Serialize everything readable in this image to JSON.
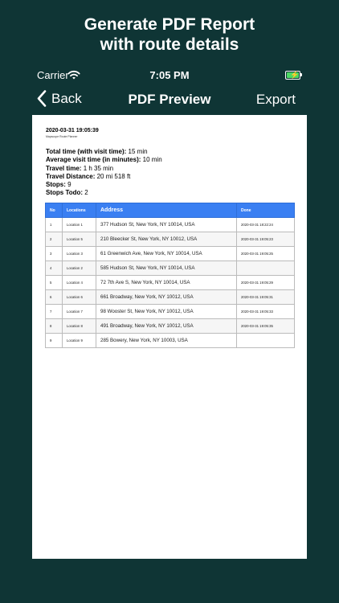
{
  "promo": {
    "line1": "Generate PDF Report",
    "line2": "with route details"
  },
  "status_bar": {
    "carrier": "Carrier",
    "time": "7:05 PM"
  },
  "nav": {
    "back_label": "Back",
    "title": "PDF Preview",
    "export_label": "Export"
  },
  "document": {
    "date": "2020-03-31 19:05:39",
    "subtitle": "Mapscope Route Planner",
    "summary": [
      {
        "label": "Total time (with visit time):",
        "value": " 15 min"
      },
      {
        "label": "Average visit time (in minutes):",
        "value": " 10 min"
      },
      {
        "label": "Travel time:",
        "value": " 1 h 35 min"
      },
      {
        "label": "Travel Distance:",
        "value": " 20 mi 518 ft"
      },
      {
        "label": "Stops:",
        "value": " 9"
      },
      {
        "label": "Stops Todo:",
        "value": " 2"
      }
    ],
    "table": {
      "headers": [
        "No",
        "Locations",
        "Address",
        "Done"
      ],
      "rows": [
        {
          "no": "1",
          "location": "Location 1",
          "address": "377 Hudson St, New York, NY 10014, USA",
          "done": "2020-03-31 18:22:24"
        },
        {
          "no": "2",
          "location": "Location 5",
          "address": "210 Bleecker St, New York, NY 10012, USA",
          "done": "2020-03-31 19:05:23"
        },
        {
          "no": "3",
          "location": "Location 3",
          "address": "61 Greenwich Ave, New York, NY 10014, USA",
          "done": "2020-03-31 19:05:25"
        },
        {
          "no": "4",
          "location": "Location 2",
          "address": "585 Hudson St, New York, NY 10014, USA",
          "done": ""
        },
        {
          "no": "5",
          "location": "Location 4",
          "address": "72 7th Ave S, New York, NY 10014, USA",
          "done": "2020-03-31 19:05:29"
        },
        {
          "no": "6",
          "location": "Location 6",
          "address": "661 Broadway, New York, NY 10012, USA",
          "done": "2020-03-31 19:05:31"
        },
        {
          "no": "7",
          "location": "Location 7",
          "address": "98 Wooster St, New York, NY 10012, USA",
          "done": "2020-03-31 19:05:33"
        },
        {
          "no": "8",
          "location": "Location 8",
          "address": "491 Broadway, New York, NY 10012, USA",
          "done": "2020-03-31 19:05:35"
        },
        {
          "no": "9",
          "location": "Location 9",
          "address": "285 Bowery, New York, NY 10003, USA",
          "done": ""
        }
      ]
    }
  },
  "colors": {
    "background": "#0f3535",
    "table_header": "#3a7ff2",
    "battery": "#4cd964"
  },
  "icons": [
    "wifi-icon",
    "battery-charging-icon",
    "chevron-left-icon"
  ]
}
